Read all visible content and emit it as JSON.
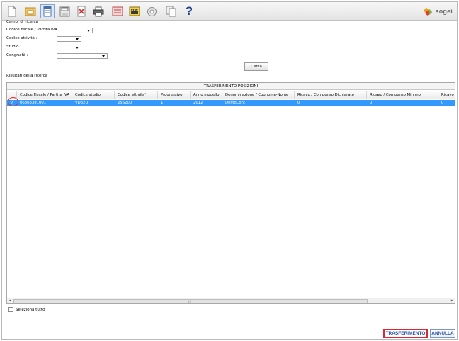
{
  "toolbar": {
    "icons": [
      "new-document-icon",
      "open-folder-icon",
      "document-window-icon",
      "save-disk-icon",
      "delete-icon",
      "print-icon",
      "form-icon",
      "ara-icon",
      "gear-icon",
      "copy-pages-icon",
      "help-icon"
    ],
    "ara_text": "ARA",
    "help_text": "?",
    "logo_text": "sogei"
  },
  "search": {
    "title": "Campi di ricerca",
    "fields": {
      "codice_fiscale_label": "Codice fiscale / Partita IVA :",
      "codice_fiscale_value": "",
      "codice_attivita_label": "Codice attività :",
      "codice_attivita_value": "",
      "studio_label": "Studio :",
      "studio_value": "",
      "congruita_label": "Congruità :",
      "congruita_value": ""
    },
    "button_label": "Cerca"
  },
  "results": {
    "title": "Risultati della ricerca",
    "grid_title": "TRASFERIMENTO POSIZIONI",
    "columns": [
      "Codice Fiscale / Partita IVA",
      "Codice studio",
      "Codice attivita'",
      "Progressivo",
      "Anno modello",
      "Denominazione / Cognome-Nome",
      "Ricavo / Compenso Dichiarato",
      "Ricavo / Compenso Minimo",
      "Ricavo /"
    ],
    "rows": [
      {
        "checked": true,
        "cells": [
          "06363391001",
          "VD32U",
          "256200",
          "1",
          "2012",
          "DemoCont",
          "0",
          "0",
          "0"
        ]
      }
    ],
    "selected_row_color": "#3399ff"
  },
  "select_all_label": "Seleziona tutto",
  "actions": {
    "transfer_label": "TRASFERIMENTO",
    "cancel_label": "ANNULLA"
  },
  "colors": {
    "highlight": "#e0262e",
    "button_text": "#2f55a4"
  }
}
